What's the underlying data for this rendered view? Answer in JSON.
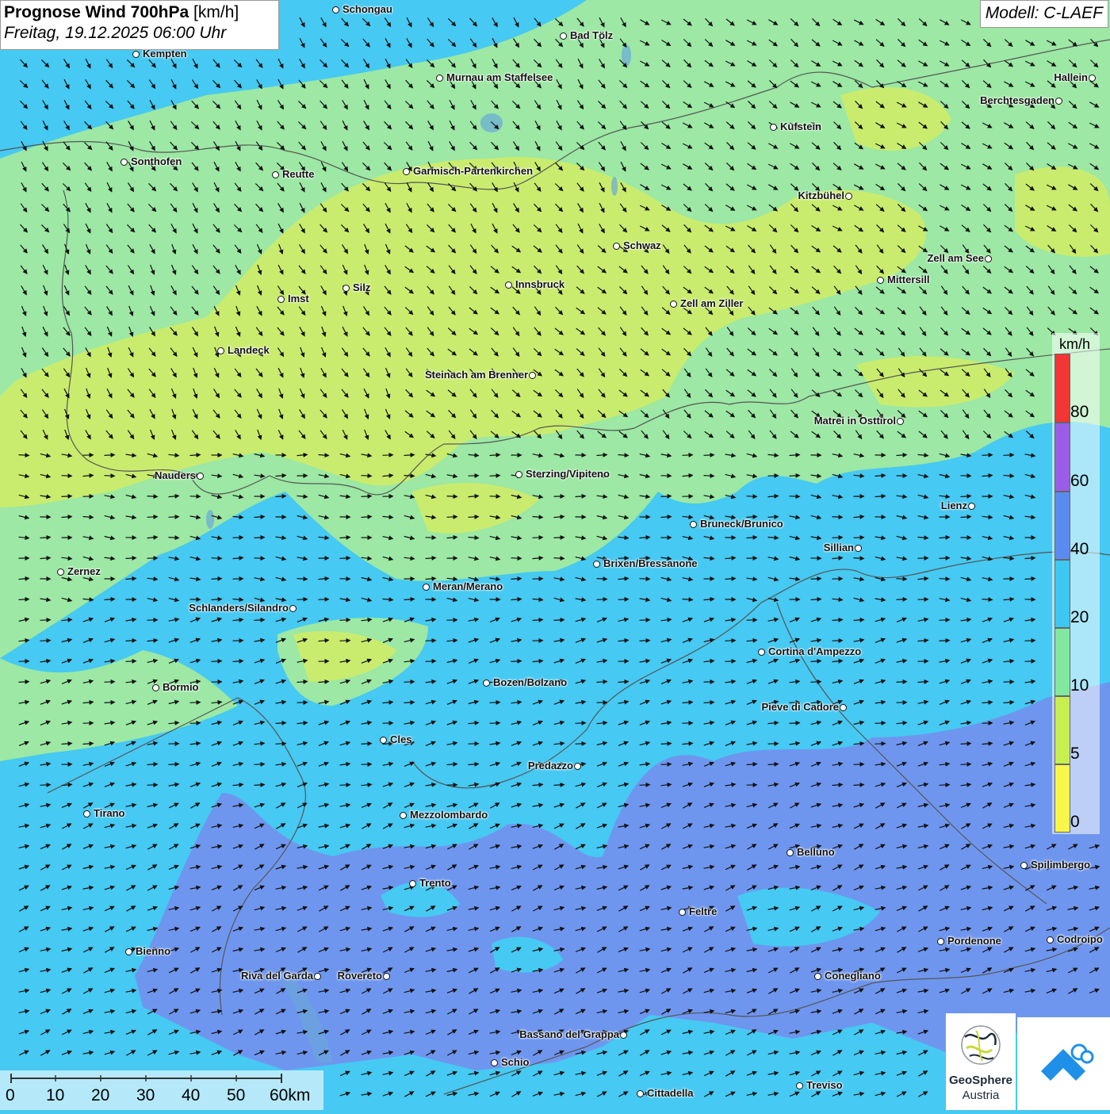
{
  "header": {
    "title": "Prognose Wind 700hPa",
    "unit": "[km/h]",
    "datetime": "Freitag, 19.12.2025 06:00 Uhr",
    "model": "Modell: C-LAEF"
  },
  "legend": {
    "unit": "km/h",
    "labels": [
      "80",
      "60",
      "40",
      "20",
      "10",
      "5",
      "0"
    ],
    "colors": [
      "#f23535",
      "#9b5de8",
      "#5a8cf0",
      "#3cc8f0",
      "#82e8a0",
      "#c8ef50",
      "#f7f74a"
    ]
  },
  "scale_bar": {
    "labels": [
      "0",
      "10",
      "20",
      "30",
      "40",
      "50",
      "60km"
    ]
  },
  "logo": {
    "name": "GeoSphere",
    "country": "Austria"
  },
  "cities": [
    {
      "name": "Schongau"
    },
    {
      "name": "Kempten"
    },
    {
      "name": "Bad Tölz"
    },
    {
      "name": "Murnau am Staffelsee"
    },
    {
      "name": "Hallein"
    },
    {
      "name": "Berchtesgaden"
    },
    {
      "name": "Kufstein"
    },
    {
      "name": "Sonthofen"
    },
    {
      "name": "Reutte"
    },
    {
      "name": "Garmisch-Partenkirchen"
    },
    {
      "name": "Kitzbühel"
    },
    {
      "name": "Schwaz"
    },
    {
      "name": "Zell am See"
    },
    {
      "name": "Mittersill"
    },
    {
      "name": "Innsbruck"
    },
    {
      "name": "Silz"
    },
    {
      "name": "Imst"
    },
    {
      "name": "Zell am Ziller"
    },
    {
      "name": "Landeck"
    },
    {
      "name": "Steinach am Brenner"
    },
    {
      "name": "Matrei in Osttirol"
    },
    {
      "name": "Nauders"
    },
    {
      "name": "Sterzing/Vipiteno"
    },
    {
      "name": "Lienz"
    },
    {
      "name": "Bruneck/Brunico"
    },
    {
      "name": "Sillian"
    },
    {
      "name": "Brixen/Bressanone"
    },
    {
      "name": "Zernez"
    },
    {
      "name": "Meran/Merano"
    },
    {
      "name": "Schlanders/Silandro"
    },
    {
      "name": "Cortina d'Ampezzo"
    },
    {
      "name": "Bozen/Bolzano"
    },
    {
      "name": "Bormio"
    },
    {
      "name": "Pieve di Cadore"
    },
    {
      "name": "Cles"
    },
    {
      "name": "Predazzo"
    },
    {
      "name": "Tirano"
    },
    {
      "name": "Mezzolombardo"
    },
    {
      "name": "Belluno"
    },
    {
      "name": "Spilimbergo"
    },
    {
      "name": "Trento"
    },
    {
      "name": "Feltre"
    },
    {
      "name": "Pordenone"
    },
    {
      "name": "Codroipo"
    },
    {
      "name": "Bienno"
    },
    {
      "name": "Riva del Garda"
    },
    {
      "name": "Rovereto"
    },
    {
      "name": "Conegliano"
    },
    {
      "name": "Bassano del Grappa"
    },
    {
      "name": "Schio"
    },
    {
      "name": "Treviso"
    },
    {
      "name": "Cittadella"
    }
  ]
}
